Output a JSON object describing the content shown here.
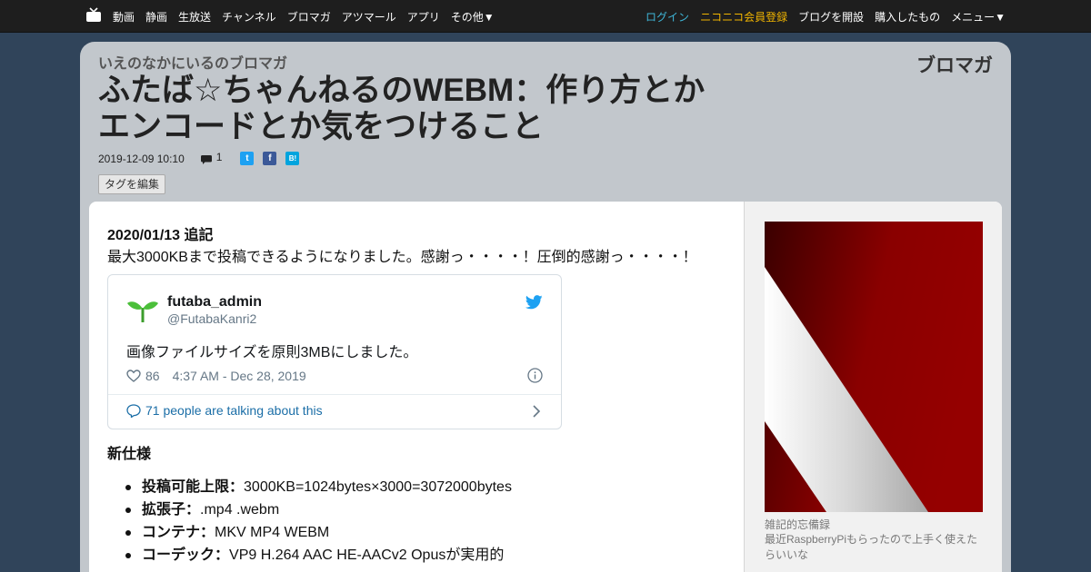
{
  "nav": {
    "left": [
      "動画",
      "静画",
      "生放送",
      "チャンネル",
      "ブロマガ",
      "アツマール",
      "アプリ",
      "その他▼"
    ],
    "right": {
      "login": "ログイン",
      "register": "ニコニコ会員登録",
      "open_blog": "ブログを開設",
      "purchased": "購入したもの",
      "menu": "メニュー▼"
    }
  },
  "header": {
    "channel": "いえのなかにいるのブロマガ",
    "brand": "ブロマガ",
    "title": "ふたば☆ちゃんねるのWEBM：作り方とかエンコードとか気をつけること",
    "datetime": "2019-12-09 10:10",
    "comment_count": "1",
    "share": {
      "twitter": "t",
      "facebook": "f",
      "hatena": "B!"
    },
    "tag_button": "タグを編集"
  },
  "article": {
    "addendum_heading": "2020/01/13 追記",
    "addendum_text": "最大3000KBまで投稿できるようになりました。感謝っ・・・・！圧倒的感謝っ・・・・！",
    "tweet": {
      "name": "futaba_admin",
      "handle": "@FutabaKanri2",
      "text": "画像ファイルサイズを原則3MBにしました。",
      "likes": "86",
      "date": "4:37 AM - Dec 28, 2019",
      "talking": "71 people are talking about this"
    },
    "spec_heading": "新仕様",
    "spec_items": [
      {
        "label": "投稿可能上限：",
        "value": "3000KB=1024bytes×3000=3072000bytes"
      },
      {
        "label": "拡張子：",
        "value": ".mp4 .webm"
      },
      {
        "label": "コンテナ：",
        "value": "MKV MP4 WEBM"
      },
      {
        "label": "コーデック：",
        "value": "VP9 H.264 AAC HE-AACv2 Opusが実用的"
      }
    ]
  },
  "sidebar": {
    "title": "雑記的忘備録",
    "description": "最近RaspberryPiもらったので上手く使えたらいいな"
  },
  "colors": {
    "page_bg": "#30445a",
    "card_bg": "#c2c7cc",
    "login": "#3fb6d8",
    "register": "#f0b400",
    "link": "#1b6ea7"
  }
}
